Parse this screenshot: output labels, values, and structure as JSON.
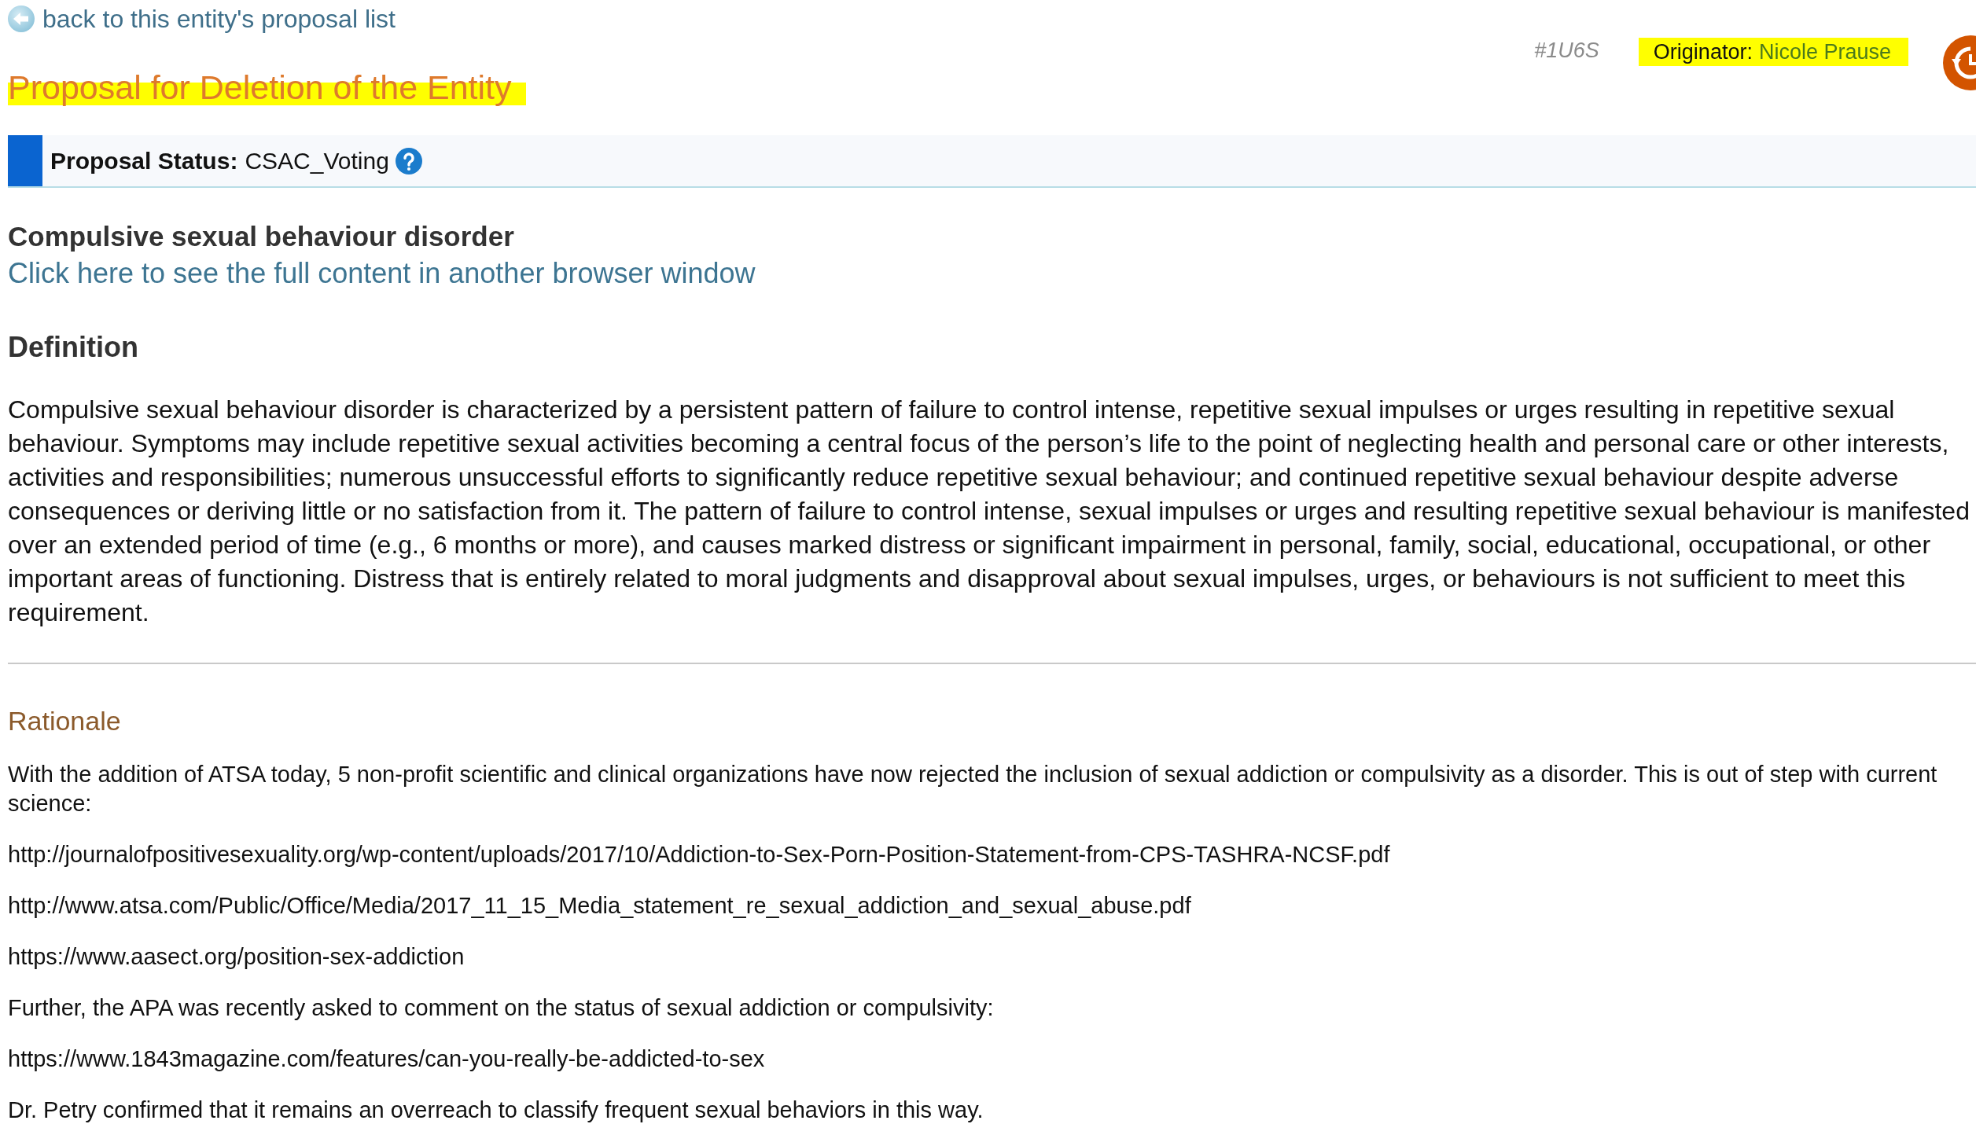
{
  "back_link": {
    "label": "back to this entity's proposal list"
  },
  "title": {
    "text": "Proposal for Deletion of the Entity",
    "highlighted": true
  },
  "proposal_id": "#1U6S",
  "originator": {
    "label": "Originator:",
    "name": "Nicole Prause",
    "highlighted": true
  },
  "status": {
    "label": "Proposal Status:",
    "value": "CSAC_Voting"
  },
  "entity": {
    "title": "Compulsive sexual behaviour disorder",
    "link": "Click here to see the full content in another browser window"
  },
  "definition": {
    "heading": "Definition",
    "text": "Compulsive sexual behaviour disorder is characterized by a persistent pattern of failure to control intense, repetitive sexual impulses or urges resulting in repetitive sexual behaviour. Symptoms may include repetitive sexual activities becoming a central focus of the person’s life to the point of neglecting health and personal care or other interests, activities and responsibilities; numerous unsuccessful efforts to significantly reduce repetitive sexual behaviour; and continued repetitive sexual behaviour despite adverse consequences or deriving little or no satisfaction from it. The pattern of failure to control intense, sexual impulses or urges and resulting repetitive sexual behaviour is manifested over an extended period of time (e.g., 6 months or more), and causes marked distress or significant impairment in personal, family, social, educational, occupational, or other important areas of functioning. Distress that is entirely related to moral judgments and disapproval about sexual impulses, urges, or behaviours is not sufficient to meet this requirement."
  },
  "rationale": {
    "heading": "Rationale",
    "paragraphs": [
      "With the addition of ATSA today, 5 non-profit scientific and clinical organizations have now rejected the inclusion of sexual addiction or compulsivity as a disorder. This is out of step with current science:",
      "http://journalofpositivesexuality.org/wp-content/uploads/2017/10/Addiction-to-Sex-Porn-Position-Statement-from-CPS-TASHRA-NCSF.pdf",
      "http://www.atsa.com/Public/Office/Media/2017_11_15_Media_statement_re_sexual_addiction_and_sexual_abuse.pdf",
      "https://www.aasect.org/position-sex-addiction",
      "Further, the APA was recently asked to comment on the status of sexual addiction or compulsivity:",
      "https://www.1843magazine.com/features/can-you-really-be-addicted-to-sex",
      "Dr. Petry confirmed that it remains an overreach to classify frequent sexual behaviors in this way."
    ]
  }
}
